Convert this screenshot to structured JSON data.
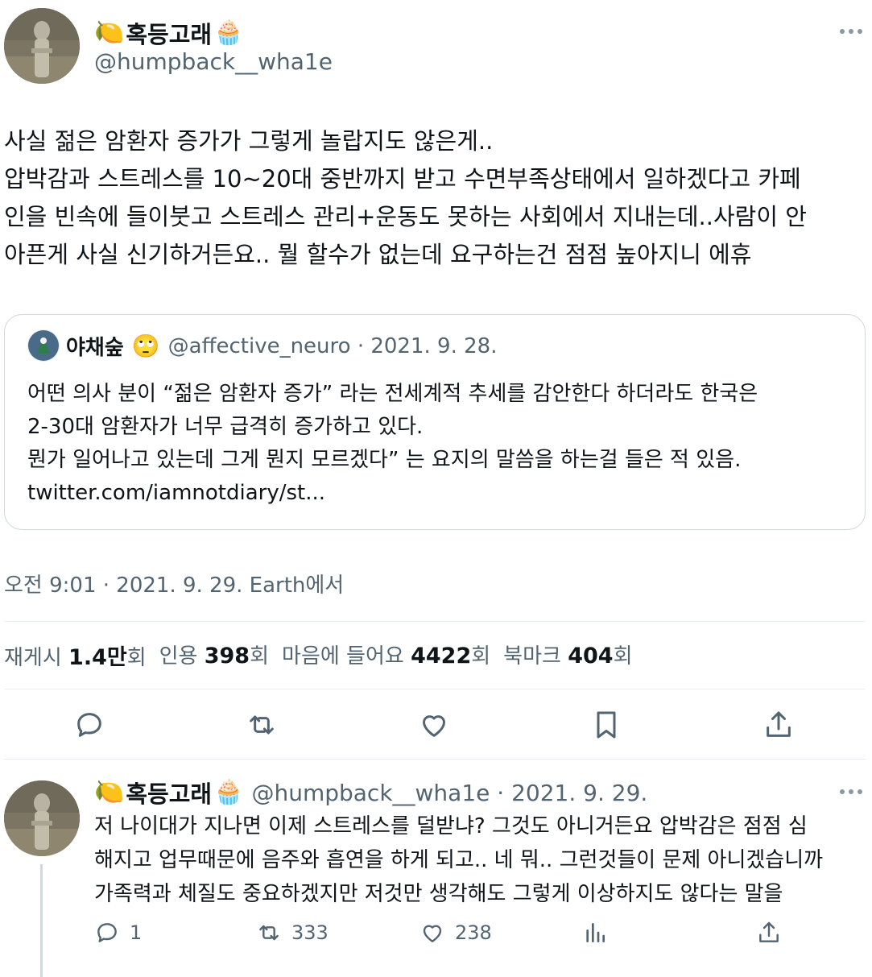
{
  "main_tweet": {
    "emoji_left": "🍋",
    "display_name": "혹등고래",
    "emoji_right": "🧁",
    "handle": "@humpback__wha1e",
    "text_lines": [
      "사실 젊은 암환자 증가가 그렇게 놀랍지도 않은게..",
      "압박감과 스트레스를 10~20대 중반까지 받고 수면부족상태에서 일하겠다고 카페",
      "인을 빈속에 들이붓고 스트레스 관리+운동도 못하는 사회에서 지내는데..사람이 안",
      "아픈게 사실 신기하거든요.. 뭘 할수가 없는데 요구하는건 점점 높아지니 에휴"
    ],
    "timestamp": "오전 9:01 · 2021. 9. 29. Earth에서"
  },
  "quote_tweet": {
    "display_name": "야채숲",
    "emoji": "🙄",
    "meta": "@affective_neuro · 2021. 9. 28.",
    "text_lines": [
      "어떤 의사 분이 “젊은 암환자 증가” 라는 전세계적 추세를 감안한다 하더라도 한국은",
      "2-30대 암환자가 너무 급격히 증가하고 있다.",
      "뭔가 일어나고 있는데 그게 뭔지 모르겠다” 는 요지의 말씀을 하는걸 들은 적 있음.",
      "twitter.com/iamnotdiary/st..."
    ]
  },
  "stats": {
    "retweets_label": "재게시",
    "retweets_value": "1.4만",
    "retweets_unit": "회",
    "quotes_label": "인용",
    "quotes_value": "398",
    "quotes_unit": "회",
    "likes_label": "마음에 들어요",
    "likes_value": "4422",
    "likes_unit": "회",
    "bookmarks_label": "북마크",
    "bookmarks_value": "404",
    "bookmarks_unit": "회"
  },
  "actions": {
    "icons": [
      "reply-icon",
      "retweet-icon",
      "like-icon",
      "bookmark-icon",
      "share-icon"
    ]
  },
  "reply_tweet": {
    "emoji_left": "🍋",
    "display_name": "혹등고래",
    "emoji_right": "🧁",
    "meta": "@humpback__wha1e · 2021. 9. 29.",
    "text_lines": [
      "저 나이대가 지나면 이제 스트레스를 덜받냐? 그것도 아니거든요 압박감은 점점 심",
      "해지고 업무때문에 음주와 흡연을 하게 되고.. 네 뭐.. 그런것들이 문제 아니겠습니까",
      "가족력과 체질도 중요하겠지만 저것만 생각해도 그렇게 이상하지도 않다는 말을"
    ],
    "reply_count": "1",
    "retweet_count": "333",
    "like_count": "238"
  },
  "colors": {
    "text": "#0f1419",
    "secondary": "#536471",
    "border": "#cfd9de",
    "icon": "#536471"
  }
}
